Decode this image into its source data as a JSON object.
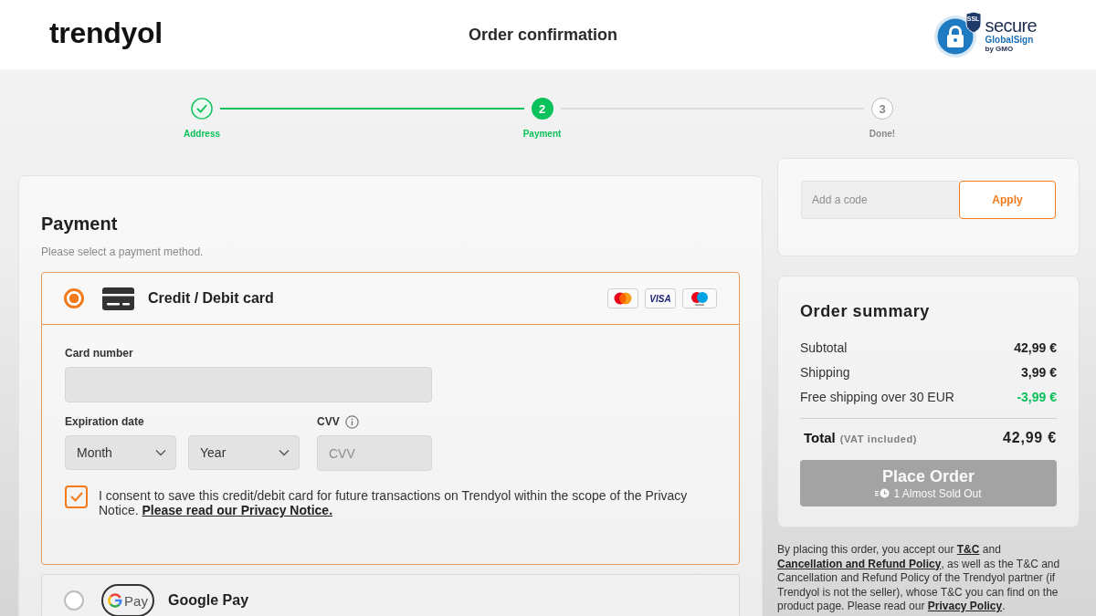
{
  "header": {
    "logo": "trendyol",
    "title": "Order confirmation",
    "ssl_badge": {
      "tag": "SSL",
      "word": "secure",
      "brand": "GlobalSign",
      "by_line": "by GMO"
    }
  },
  "steps": [
    {
      "label": "Address",
      "completed": true,
      "selected": false
    },
    {
      "label": "Payment",
      "number": "2",
      "completed": false,
      "selected": true
    },
    {
      "label": "Done!",
      "number": "3",
      "completed": false,
      "selected": false
    }
  ],
  "payment": {
    "title": "Payment",
    "subtitle": "Please select a payment method.",
    "methods": [
      {
        "kind": "card",
        "label": "Credit / Debit card",
        "selected": true,
        "brands": [
          {
            "kind": "mastercard"
          },
          {
            "kind": "visa",
            "text": "VISA"
          },
          {
            "kind": "maestro"
          }
        ],
        "form": {
          "card_number": {
            "label": "Card number"
          },
          "expiration": {
            "label": "Expiration date",
            "month": "Month",
            "year": "Year"
          },
          "cvv": {
            "label": "CVV",
            "placeholder": "CVV"
          },
          "consent": {
            "checked": true,
            "text": "I consent to save this credit/debit card for future transactions on Trendyol within the scope of the Privacy Notice.",
            "link": "Please read our Privacy Notice."
          }
        }
      },
      {
        "kind": "google_pay",
        "label": "Google Pay",
        "logo_text": "Pay",
        "selected": false
      }
    ]
  },
  "coupon": {
    "placeholder": "Add a code",
    "button": "Apply"
  },
  "order_summary": {
    "title": "Order summary",
    "rows": [
      {
        "label": "Subtotal",
        "value": "42,99 €",
        "kind": "normal"
      },
      {
        "label": "Shipping",
        "value": "3,99 €",
        "kind": "normal"
      },
      {
        "label": "Free shipping over 30 EUR",
        "value": "-3,99 €",
        "kind": "discount"
      }
    ],
    "total": {
      "label": "Total",
      "note": "(VAT included)",
      "value": "42,99 €"
    },
    "place_order": {
      "label": "Place Order",
      "note": "1 Almost Sold Out",
      "disabled": true
    }
  },
  "legal_text": [
    {
      "kind": "text",
      "text": "By placing this order, you accept our "
    },
    {
      "kind": "link",
      "text": "T&C"
    },
    {
      "kind": "text",
      "text": " and "
    },
    {
      "kind": "link",
      "text": "Cancellation and Refund Policy"
    },
    {
      "kind": "text",
      "text": ", as well as the T&C and Cancellation and Refund Policy of the Trendyol partner (if Trendyol is not the seller), whose T&C you can find on the product page. Please read our "
    },
    {
      "kind": "link",
      "text": "Privacy Policy"
    },
    {
      "kind": "text",
      "text": "."
    }
  ]
}
